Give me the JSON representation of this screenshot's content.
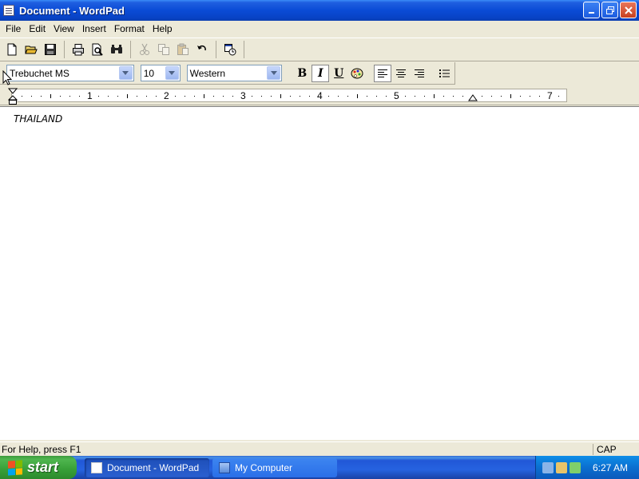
{
  "window": {
    "title": "Document - WordPad"
  },
  "menu": {
    "items": [
      "File",
      "Edit",
      "View",
      "Insert",
      "Format",
      "Help"
    ]
  },
  "toolbar": {
    "buttons": [
      "new-icon",
      "open-icon",
      "save-icon",
      "print-icon",
      "print-preview-icon",
      "find-icon",
      "cut-icon",
      "copy-icon",
      "paste-icon",
      "undo-icon",
      "date-time-icon"
    ]
  },
  "format_bar": {
    "font": "Trebuchet MS",
    "size": "10",
    "script": "Western",
    "bold_label": "B",
    "italic_label": "I",
    "underline_label": "U"
  },
  "ruler": {
    "numbers": [
      "1",
      "2",
      "3",
      "4",
      "5",
      "7"
    ]
  },
  "document": {
    "text": "THAILAND"
  },
  "status": {
    "help": "For Help, press F1",
    "caps": "CAP"
  },
  "taskbar": {
    "start_label": "start",
    "tasks": [
      {
        "label": "Document - WordPad"
      },
      {
        "label": "My Computer"
      }
    ],
    "clock": "6:27 AM"
  },
  "colors": {
    "titlebar": "#0a4bd6",
    "taskbar": "#2663e0",
    "start": "#379f37",
    "tray": "#0b6fd0"
  }
}
